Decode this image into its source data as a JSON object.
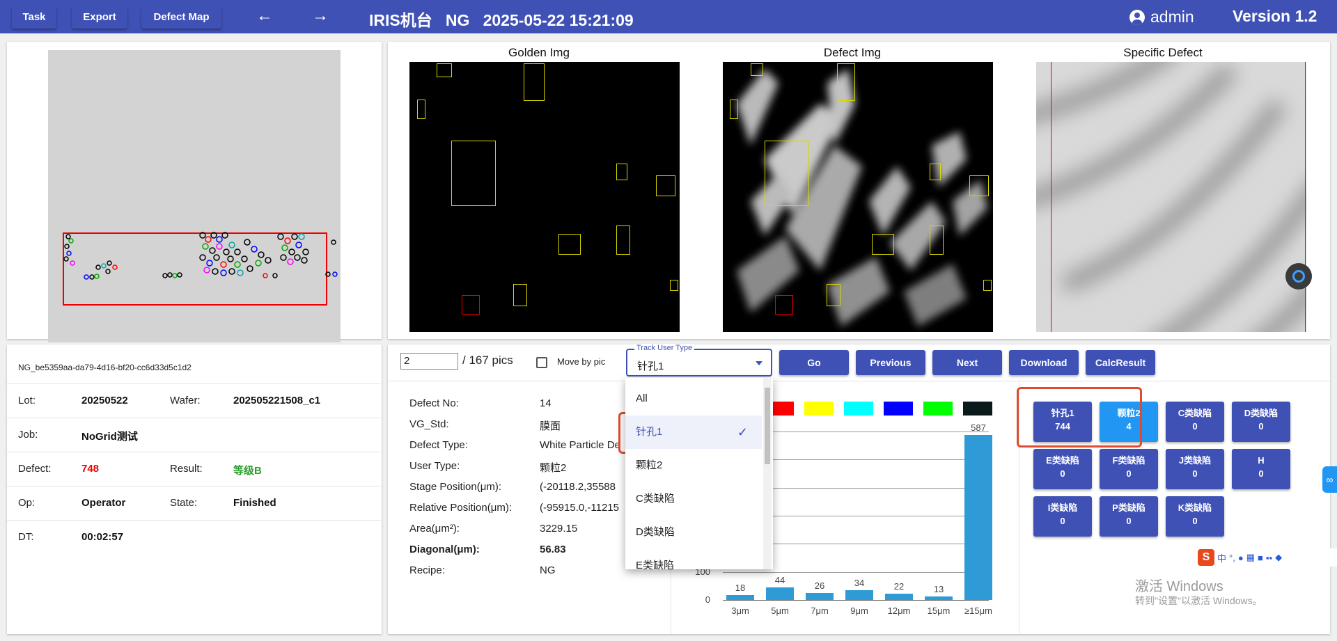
{
  "header": {
    "task_label": "Task",
    "export_label": "Export",
    "defect_map_label": "Defect Map",
    "back_arrow": "←",
    "forward_arrow": "→",
    "title": "IRIS机台   NG   2025-05-22 15:21:09",
    "user": "admin",
    "version": "Version 1.2"
  },
  "images": {
    "golden_title": "Golden Img",
    "defect_title": "Defect Img",
    "specific_title": "Specific Defect"
  },
  "info": {
    "id": "NG_be5359aa-da79-4d16-bf20-cc6d33d5c1d2",
    "lot_label": "Lot:",
    "lot": "20250522",
    "wafer_label": "Wafer:",
    "wafer": "202505221508_c1",
    "job_label": "Job:",
    "job": "NoGrid测试",
    "defect_label": "Defect:",
    "defect": "748",
    "result_label": "Result:",
    "result": "等级B",
    "op_label": "Op:",
    "op": "Operator",
    "state_label": "State:",
    "state": "Finished",
    "dt_label": "DT:",
    "dt": "00:02:57"
  },
  "controls": {
    "page_value": "2",
    "total_pics": "/ 167 pics",
    "move_by_pic": "Move by pic",
    "track_label": "Track User Type",
    "track_value": "针孔1",
    "go": "Go",
    "previous": "Previous",
    "next": "Next",
    "download": "Download",
    "calc": "CalcResult"
  },
  "detail": {
    "rows": [
      {
        "label": "Defect No:",
        "value": "14"
      },
      {
        "label": "VG_Std:",
        "value": "膜面"
      },
      {
        "label": "Defect Type:",
        "value": "White Particle De"
      },
      {
        "label": "User Type:",
        "value": "颗粒2"
      },
      {
        "label": "Stage Position(μm):",
        "value": "(-20118.2,35588"
      },
      {
        "label": "Relative Position(μm):",
        "value": "(-95915.0,-11215"
      },
      {
        "label": "Area(μm²):",
        "value": "3229.15"
      },
      {
        "label": "Diagonal(μm):",
        "value": "56.83"
      },
      {
        "label": "Recipe:",
        "value": "NG"
      }
    ]
  },
  "dropdown": {
    "items": [
      "All",
      "针孔1",
      "颗粒2",
      "C类缺陷",
      "D类缺陷",
      "E类缺陷"
    ],
    "selected": "针孔1",
    "check": "✓"
  },
  "colors": [
    "#ff0000",
    "#ffff00",
    "#00ffff",
    "#0000ff",
    "#00ff00",
    "#0a1a1a"
  ],
  "chart_data": {
    "type": "bar",
    "categories": [
      "3μm",
      "5μm",
      "7μm",
      "9μm",
      "12μm",
      "15μm",
      "≥15μm"
    ],
    "values": [
      18,
      44,
      26,
      34,
      22,
      13,
      587
    ],
    "yticks": [
      "0",
      "100"
    ],
    "ylim": [
      0,
      600
    ],
    "grid": true,
    "color": "#2e9bd6"
  },
  "defect_buttons": [
    {
      "name": "针孔1",
      "count": "744"
    },
    {
      "name": "颗粒2",
      "count": "4"
    },
    {
      "name": "C类缺陷",
      "count": "0"
    },
    {
      "name": "D类缺陷",
      "count": "0"
    },
    {
      "name": "E类缺陷",
      "count": "0"
    },
    {
      "name": "F类缺陷",
      "count": "0"
    },
    {
      "name": "J类缺陷",
      "count": "0"
    },
    {
      "name": "H",
      "count": "0"
    },
    {
      "name": "I类缺陷",
      "count": "0"
    },
    {
      "name": "P类缺陷",
      "count": "0"
    },
    {
      "name": "K类缺陷",
      "count": "0"
    }
  ],
  "watermark": {
    "line1": "激活 Windows",
    "line2": "转到\"设置\"以激活 Windows。"
  },
  "ime": {
    "logo": "S",
    "lang": "中"
  }
}
